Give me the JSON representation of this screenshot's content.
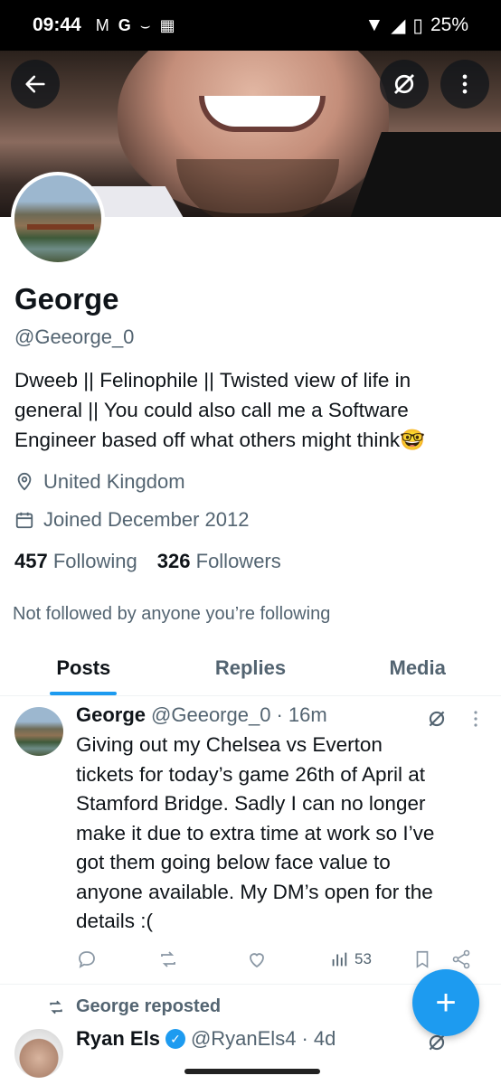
{
  "statusbar": {
    "time": "09:44",
    "icons": [
      "gmail-icon",
      "google-icon",
      "amazon-icon",
      "calendar-icon"
    ],
    "battery": "25%"
  },
  "profile": {
    "name": "George",
    "handle": "@Geeorge_0",
    "bio_lines": [
      "Dweeb || Felinophile || Twisted view of life in",
      "general || You could also call me a Software",
      "Engineer based off what others might think🤓"
    ],
    "location": "United Kingdom",
    "joined": "Joined December 2012",
    "following_count": "457",
    "following_label": "Following",
    "followers_count": "326",
    "followers_label": "Followers",
    "not_followed_text": "Not followed by anyone you’re following"
  },
  "tabs": [
    {
      "label": "Posts",
      "active": true
    },
    {
      "label": "Replies",
      "active": false
    },
    {
      "label": "Media",
      "active": false
    }
  ],
  "post1": {
    "name": "George",
    "handle": "@Geeorge_0",
    "time": "· 16m",
    "text_lines": [
      "Giving out my Chelsea vs Everton",
      "tickets for today’s game 26th of April at",
      "Stamford Bridge. Sadly I can no longer",
      "make it due to extra time at work so I’ve",
      "got them going below face value to",
      "anyone available. My DM’s open for the",
      "details :("
    ],
    "views": "53"
  },
  "repost": {
    "label": "George reposted",
    "name": "Ryan Els",
    "handle": "@RyanEls4",
    "time": "· 4d"
  },
  "fab_label": "+",
  "colors": {
    "accent": "#1d9bf0",
    "text_primary": "#0f1419",
    "text_secondary": "#536471"
  }
}
